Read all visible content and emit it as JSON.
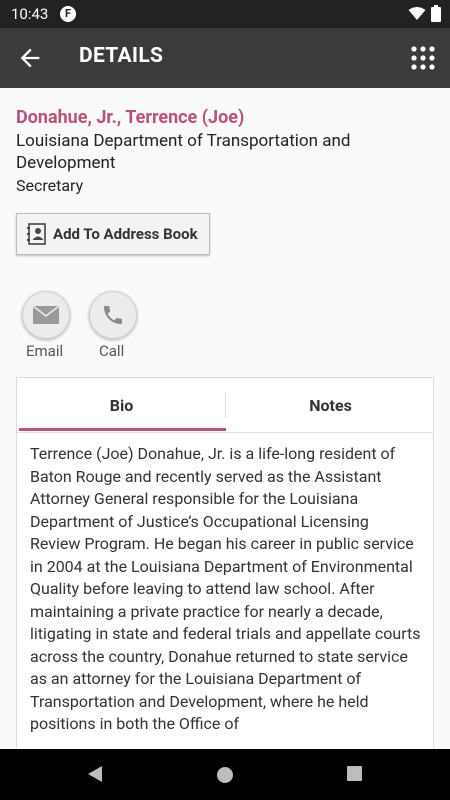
{
  "status_bar": {
    "time": "10:43",
    "app_icon_letter": "F"
  },
  "app_bar": {
    "title": "DETAILS",
    "back_icon": "arrow-left-icon",
    "menu_icon": "grid-icon"
  },
  "contact": {
    "name": "Donahue, Jr., Terrence (Joe)",
    "organization": "Louisiana Department of Transportation and Development",
    "title": "Secretary"
  },
  "actions": {
    "add_to_address_book": "Add To Address Book",
    "email_label": "Email",
    "call_label": "Call"
  },
  "tabs": [
    {
      "label": "Bio",
      "active": true
    },
    {
      "label": "Notes",
      "active": false
    }
  ],
  "bio": "Terrence (Joe) Donahue, Jr. is a life-long resident of Baton Rouge and recently served as the Assistant Attorney General responsible for the Louisiana Department of Justice’s Occupational Licensing Review Program. He began his career in public service in 2004 at the Louisiana Department of Environmental Quality before leaving to attend law school. After maintaining a private practice for nearly a decade, litigating in state and federal trials and appellate courts across the country, Donahue returned to state service as an attorney for the Louisiana Department of Transportation and Development, where he held positions in both the Office of",
  "colors": {
    "accent": "#b8527a",
    "app_bar": "#3b3b3b",
    "status_bar": "#222222",
    "nav_bar": "#000000"
  }
}
